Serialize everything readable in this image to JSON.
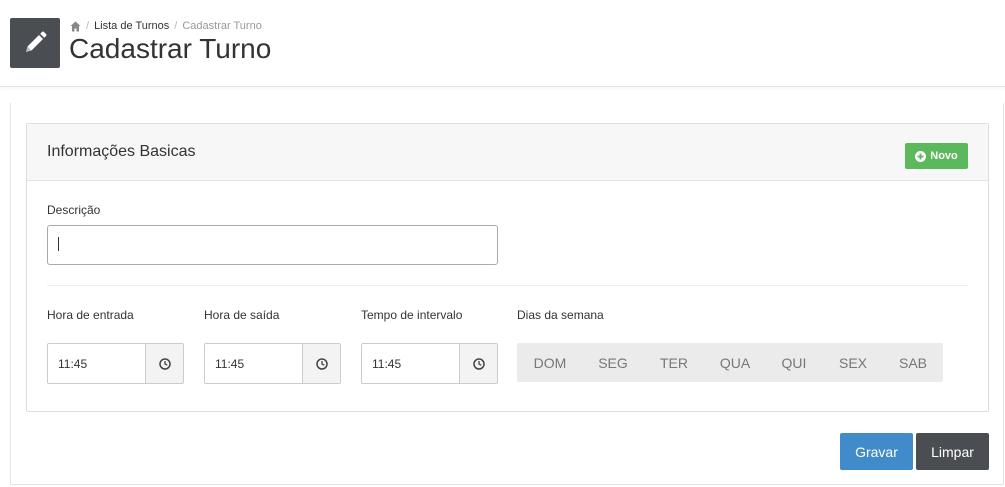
{
  "header": {
    "icon": "pencil-icon",
    "breadcrumb": {
      "home_icon": "home-icon",
      "items": [
        "Lista de Turnos",
        "Cadastrar Turno"
      ]
    },
    "title": "Cadastrar Turno"
  },
  "panel": {
    "title": "Informações Basicas",
    "new_button": "Novo",
    "new_button_icon": "plus-circle-icon",
    "new_button_color": "#5cb85c"
  },
  "form": {
    "descricao": {
      "label": "Descrição",
      "value": ""
    },
    "hora_entrada": {
      "label": "Hora de entrada",
      "value": "11:45",
      "icon": "clock-icon"
    },
    "hora_saida": {
      "label": "Hora de saída",
      "value": "11:45",
      "icon": "clock-icon"
    },
    "tempo_intervalo": {
      "label": "Tempo de intervalo",
      "value": "11:45",
      "icon": "clock-icon"
    },
    "dias_semana": {
      "label": "Dias da semana",
      "days": [
        "DOM",
        "SEG",
        "TER",
        "QUA",
        "QUI",
        "SEX",
        "SAB"
      ]
    }
  },
  "actions": {
    "save": "Gravar",
    "save_color": "#428bca",
    "clear": "Limpar",
    "clear_color": "#4a4d52"
  }
}
